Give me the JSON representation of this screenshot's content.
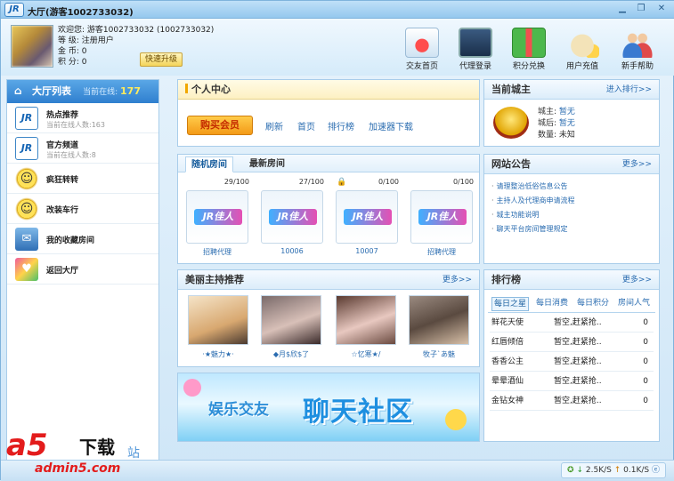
{
  "window": {
    "logo": "JR",
    "title": "大厅(游客1002733032)"
  },
  "user": {
    "welcome": "欢迎您: 游客1002733032 (1002733032)",
    "level_label": "等    级:",
    "level_value": "注册用户",
    "gold_label": "金    币:",
    "gold_value": "0",
    "points_label": "积    分:",
    "points_value": "0",
    "upgrade": "快速升级"
  },
  "topnav": [
    {
      "label": "交友首页",
      "icon": "house-heart-icon",
      "color": "#d33"
    },
    {
      "label": "代理登录",
      "icon": "monitor-icon",
      "color": "#2a6cb0"
    },
    {
      "label": "积分兑换",
      "icon": "gift-icon",
      "color": "#3aa33a"
    },
    {
      "label": "用户充值",
      "icon": "money-bag-icon",
      "color": "#d59a00"
    },
    {
      "label": "新手帮助",
      "icon": "users-icon",
      "color": "#3a7ad0"
    }
  ],
  "sidebar": {
    "title": "大厅列表",
    "online_label": "当前在线:",
    "online_value": "177",
    "items": [
      {
        "title": "热点推荐",
        "sub": "当前在线人数:163",
        "icon": "jr-logo-icon"
      },
      {
        "title": "官方频道",
        "sub": "当前在线人数:8",
        "icon": "jr-logo-icon"
      },
      {
        "title": "疯狂转转",
        "sub": "",
        "icon": "smiley-icon"
      },
      {
        "title": "改装车行",
        "sub": "",
        "icon": "smiley-icon"
      },
      {
        "title": "我的收藏房间",
        "sub": "",
        "icon": "mail-icon"
      },
      {
        "title": "返回大厅",
        "sub": "",
        "icon": "heart-icon"
      }
    ]
  },
  "center": {
    "title": "个人中心",
    "vip": "购买会员",
    "links": [
      "刷新",
      "首页",
      "排行榜",
      "加速器下载"
    ]
  },
  "rooms": {
    "tabs": [
      "随机房间",
      "最新房间"
    ],
    "list": [
      {
        "count": "29/100",
        "name": "招聘代理",
        "locked": false,
        "logo": "JR佳人"
      },
      {
        "count": "27/100",
        "name": "10006",
        "locked": false,
        "logo": "JR佳人"
      },
      {
        "count": "0/100",
        "name": "10007",
        "locked": true,
        "logo": "JR佳人"
      },
      {
        "count": "0/100",
        "name": "招聘代理",
        "locked": false,
        "logo": "JR佳人"
      }
    ]
  },
  "hosts": {
    "title": "美丽主持推荐",
    "more": "更多>>",
    "list": [
      {
        "name": "·★魅力★·",
        "tone": "#e8c9a0"
      },
      {
        "name": "◆月$欣$了",
        "tone": "#c9a8a0"
      },
      {
        "name": "☆忆寒★/",
        "tone": "#d9b4b0"
      },
      {
        "name": "牧子`あ魅",
        "tone": "#a3866e"
      }
    ]
  },
  "banner": {
    "small": "娱乐交友",
    "big": "聊天社区"
  },
  "castle": {
    "title": "当前城主",
    "more": "进入排行>>",
    "lord_label": "城主:",
    "lord_value": "暂无",
    "queen_label": "城后:",
    "queen_value": "暂无",
    "amount_label": "数量:",
    "amount_value": "未知"
  },
  "notice": {
    "title": "网站公告",
    "more": "更多>>",
    "items": [
      "请理整治低俗信息公告",
      "主持人及代理商申请流程",
      "城主功能说明",
      "聊天平台房间管理规定"
    ]
  },
  "rank": {
    "title": "排行榜",
    "more": "更多>>",
    "tabs": [
      "每日之星",
      "每日消费",
      "每日积分",
      "房间人气"
    ],
    "rows": [
      {
        "name": "鲜花天使",
        "holder": "暂空,赶紧抢..",
        "value": "0"
      },
      {
        "name": "红唇倾倍",
        "holder": "暂空,赶紧抢..",
        "value": "0"
      },
      {
        "name": "香香公主",
        "holder": "暂空,赶紧抢..",
        "value": "0"
      },
      {
        "name": "晕晕酒仙",
        "holder": "暂空,赶紧抢..",
        "value": "0"
      },
      {
        "name": "金钻女神",
        "holder": "暂空,赶紧抢..",
        "value": "0"
      }
    ]
  },
  "status": {
    "down": "2.5K/S",
    "up": "0.1K/S"
  },
  "watermark": {
    "brand": "a5",
    "download": "下载",
    "zhan": "站",
    "url": "admin5.com"
  }
}
